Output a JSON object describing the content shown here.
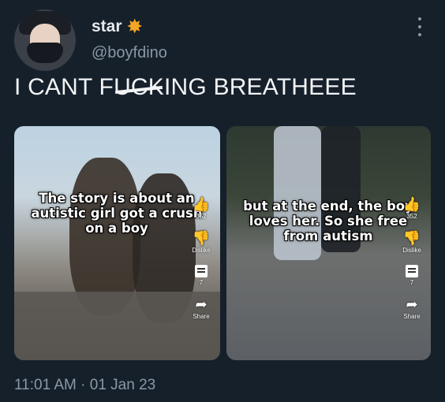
{
  "user": {
    "display_name": "star",
    "badge_icon": "sun-emoji",
    "handle": "@boyfdino"
  },
  "tweet": {
    "text_before": "I CANT F",
    "text_struck": "UCK",
    "text_after": "ING BREATHEEE",
    "timestamp": "11:01 AM · 01 Jan 23"
  },
  "media": [
    {
      "caption": "The story is about an\nautistic girl got a crush\non a boy",
      "like_count": "352",
      "dislike_label": "Dislike",
      "comment_count": "7",
      "share_label": "Share"
    },
    {
      "caption": "but at the end, the boy\nloves her. So she free\nfrom autism",
      "like_count": "352",
      "dislike_label": "Dislike",
      "comment_count": "7",
      "share_label": "Share"
    }
  ],
  "colors": {
    "background": "#15202b",
    "text_primary": "#e7e9ea",
    "text_secondary": "#8b98a5",
    "badge": "#f5a623"
  }
}
